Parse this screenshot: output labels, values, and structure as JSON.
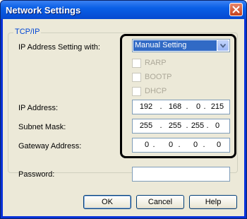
{
  "window": {
    "title": "Network Settings"
  },
  "group": {
    "title": "TCP/IP",
    "ip_setting_label": "IP Address Setting with:",
    "ip_setting_selected": "Manual Setting",
    "options": [
      {
        "label": "RARP",
        "checked": false,
        "enabled": false
      },
      {
        "label": "BOOTP",
        "checked": false,
        "enabled": false
      },
      {
        "label": "DHCP",
        "checked": false,
        "enabled": false
      }
    ],
    "ip_address": {
      "label": "IP Address:",
      "octets": [
        "192",
        "168",
        "0",
        "215"
      ]
    },
    "subnet_mask": {
      "label": "Subnet Mask:",
      "octets": [
        "255",
        "255",
        "255",
        "0"
      ]
    },
    "gateway": {
      "label": "Gateway Address:",
      "octets": [
        "0",
        "0",
        "0",
        "0"
      ]
    }
  },
  "password": {
    "label": "Password:",
    "value": ""
  },
  "buttons": {
    "ok": "OK",
    "cancel": "Cancel",
    "help": "Help"
  },
  "colors": {
    "title_bar": "#0a5fe6",
    "dialog_bg": "#ece9d8",
    "selection": "#316ac5",
    "group_title": "#0046d5",
    "highlight_frame": "#000000"
  },
  "icons": {
    "close": "close-icon",
    "dropdown": "chevron-down-icon"
  }
}
